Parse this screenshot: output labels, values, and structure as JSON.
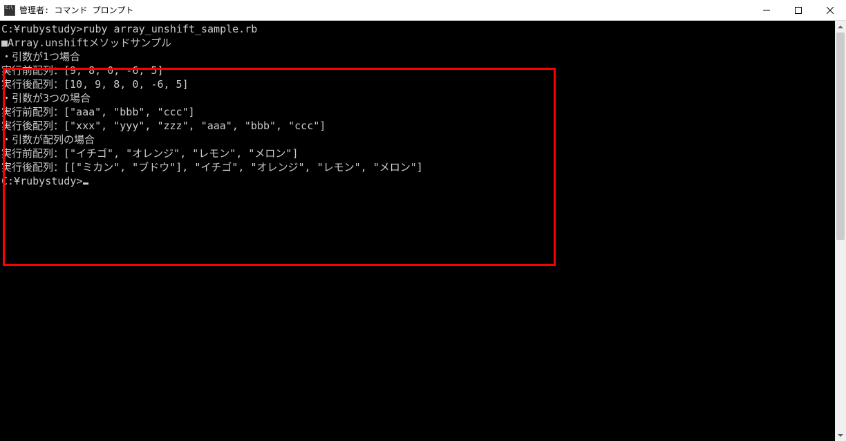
{
  "window": {
    "title": "管理者: コマンド プロンプト"
  },
  "console": {
    "line1": "C:¥rubystudy>ruby array_unshift_sample.rb",
    "line2": "■Array.unshiftメソッドサンプル",
    "line3": "",
    "line4": "・引数が1つ場合",
    "line5": "実行前配列：[9, 8, 0, -6, 5]",
    "line6": "実行後配列：[10, 9, 8, 0, -6, 5]",
    "line7": "",
    "line8": "・引数が3つの場合",
    "line9": "実行前配列：[\"aaa\", \"bbb\", \"ccc\"]",
    "line10": "実行後配列：[\"xxx\", \"yyy\", \"zzz\", \"aaa\", \"bbb\", \"ccc\"]",
    "line11": "",
    "line12": "・引数が配列の場合",
    "line13": "実行前配列：[\"イチゴ\", \"オレンジ\", \"レモン\", \"メロン\"]",
    "line14": "実行後配列：[[\"ミカン\", \"ブドウ\"], \"イチゴ\", \"オレンジ\", \"レモン\", \"メロン\"]",
    "line15": "",
    "line16": "C:¥rubystudy>"
  }
}
